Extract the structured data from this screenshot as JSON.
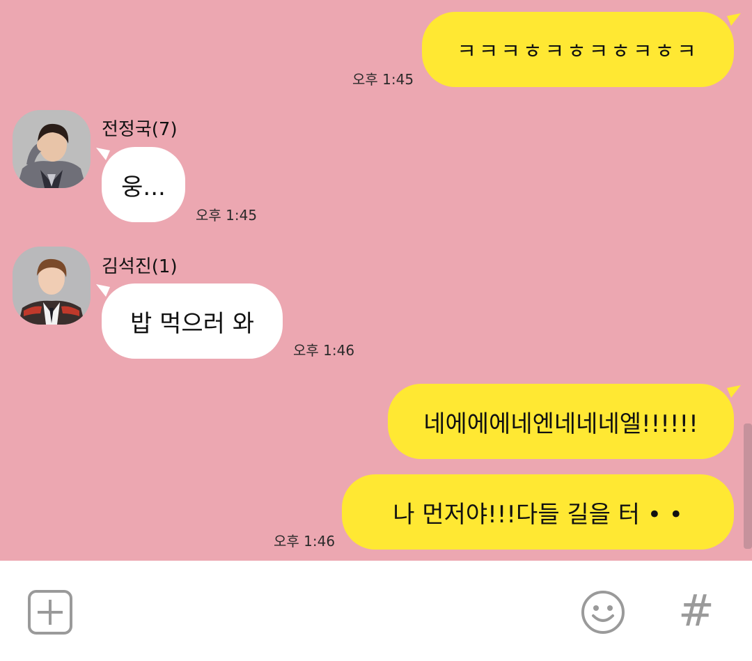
{
  "theme": {
    "chat_background": "#eca7b1",
    "my_bubble_color": "#ffe833",
    "their_bubble_color": "#ffffff",
    "bottom_bar_color": "#ffffff",
    "icon_color": "#9a9a9a"
  },
  "messages": [
    {
      "from": "me",
      "text": "ㅋㅋㅋㅎㅋㅎㅋㅎㅋㅎㅋ",
      "time": "오후 1:45"
    },
    {
      "from": "them",
      "sender": "전정국(7)",
      "text": "웅...",
      "time": "오후 1:45",
      "avatar_icon": "profile-photo-jungkook"
    },
    {
      "from": "them",
      "sender": "김석진(1)",
      "text": "밥 먹으러 와",
      "time": "오후 1:46",
      "avatar_icon": "profile-photo-seokjin"
    },
    {
      "from": "me",
      "text": "네에에에네엔네네네엘!!!!!!",
      "time": ""
    },
    {
      "from": "me",
      "text": "나 먼저야!!!다들 길을 터 • •",
      "time": "오후 1:46"
    }
  ],
  "input_bar": {
    "left_icon": "plus-icon",
    "emoji_icon": "smiley-icon",
    "hash_label": "#"
  }
}
